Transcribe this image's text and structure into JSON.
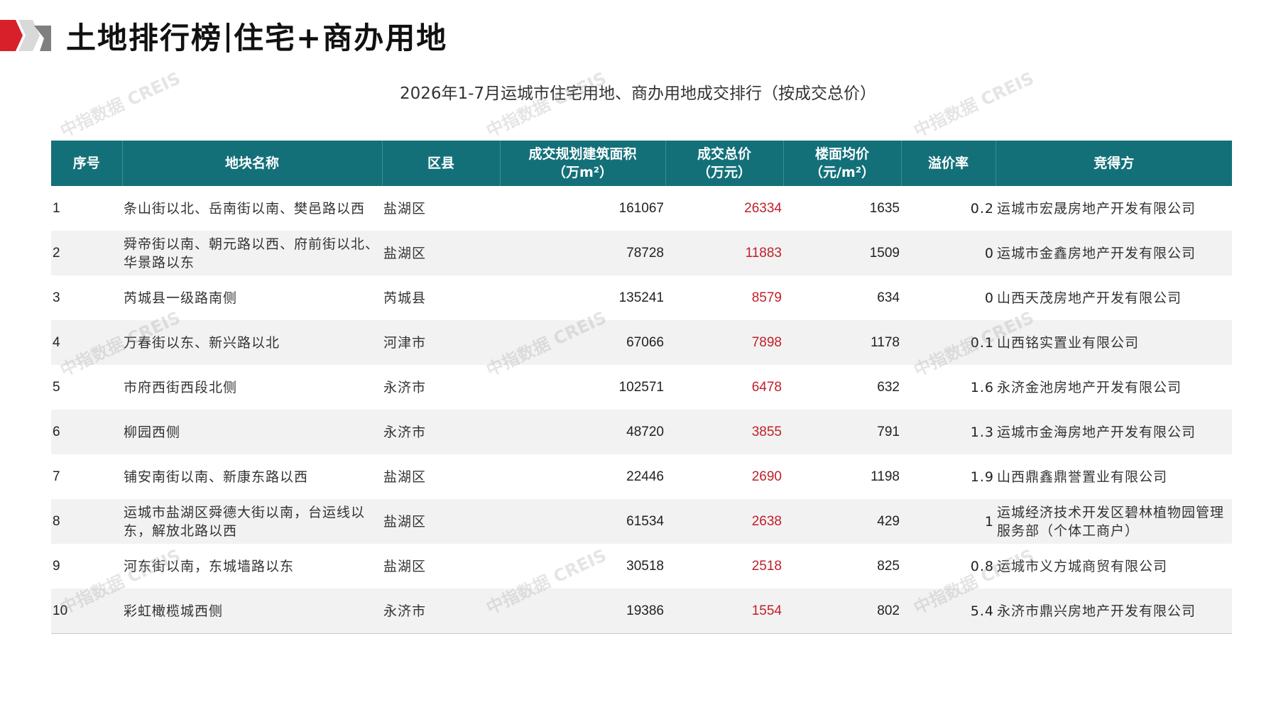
{
  "page": {
    "title_left": "土地排行榜",
    "title_right": "住宅+商办用地",
    "subtitle": "2026年1-7月运城市住宅用地、商办用地成交排行（按成交总价）"
  },
  "colors": {
    "header_bg": "#137079",
    "header_text": "#ffffff",
    "price_text": "#c0202a",
    "logo_red": "#d8202a",
    "logo_gray": "#8c8c8c",
    "stripe": "#f2f2f2"
  },
  "table": {
    "headers": [
      {
        "line1": "序号",
        "line2": ""
      },
      {
        "line1": "地块名称",
        "line2": ""
      },
      {
        "line1": "区县",
        "line2": ""
      },
      {
        "line1": "成交规划建筑面积",
        "line2": "（万m²）"
      },
      {
        "line1": "成交总价",
        "line2": "（万元）"
      },
      {
        "line1": "楼面均价",
        "line2": "（元/m²）"
      },
      {
        "line1": "溢价率",
        "line2": ""
      },
      {
        "line1": "竞得方",
        "line2": ""
      }
    ],
    "rows": [
      {
        "rank": "1",
        "name": "条山街以北、岳南街以南、樊邑路以西",
        "district": "盐湖区",
        "area": "161067",
        "total": "26334",
        "unit_price": "1635",
        "premium": "0.2",
        "buyer": "运城市宏晟房地产开发有限公司"
      },
      {
        "rank": "2",
        "name": "舜帝街以南、朝元路以西、府前街以北、华景路以东",
        "district": "盐湖区",
        "area": "78728",
        "total": "11883",
        "unit_price": "1509",
        "premium": "0",
        "buyer": "运城市金鑫房地产开发有限公司"
      },
      {
        "rank": "3",
        "name": "芮城县一级路南侧",
        "district": "芮城县",
        "area": "135241",
        "total": "8579",
        "unit_price": "634",
        "premium": "0",
        "buyer": "山西天茂房地产开发有限公司"
      },
      {
        "rank": "4",
        "name": "万春街以东、新兴路以北",
        "district": "河津市",
        "area": "67066",
        "total": "7898",
        "unit_price": "1178",
        "premium": "0.1",
        "buyer": "山西铭实置业有限公司"
      },
      {
        "rank": "5",
        "name": "市府西街西段北侧",
        "district": "永济市",
        "area": "102571",
        "total": "6478",
        "unit_price": "632",
        "premium": "1.6",
        "buyer": "永济金池房地产开发有限公司"
      },
      {
        "rank": "6",
        "name": "柳园西侧",
        "district": "永济市",
        "area": "48720",
        "total": "3855",
        "unit_price": "791",
        "premium": "1.3",
        "buyer": "运城市金海房地产开发有限公司"
      },
      {
        "rank": "7",
        "name": "铺安南街以南、新康东路以西",
        "district": "盐湖区",
        "area": "22446",
        "total": "2690",
        "unit_price": "1198",
        "premium": "1.9",
        "buyer": "山西鼎鑫鼎誉置业有限公司"
      },
      {
        "rank": "8",
        "name": "运城市盐湖区舜德大街以南，台运线以东，解放北路以西",
        "district": "盐湖区",
        "area": "61534",
        "total": "2638",
        "unit_price": "429",
        "premium": "1",
        "buyer": "运城经济技术开发区碧林植物园管理服务部（个体工商户）"
      },
      {
        "rank": "9",
        "name": "河东街以南，东城墙路以东",
        "district": "盐湖区",
        "area": "30518",
        "total": "2518",
        "unit_price": "825",
        "premium": "0.8",
        "buyer": "运城市义方城商贸有限公司"
      },
      {
        "rank": "10",
        "name": "彩虹橄榄城西侧",
        "district": "永济市",
        "area": "19386",
        "total": "1554",
        "unit_price": "802",
        "premium": "5.4",
        "buyer": "永济市鼎兴房地产开发有限公司"
      }
    ]
  },
  "watermark": "中指数据 CREIS"
}
